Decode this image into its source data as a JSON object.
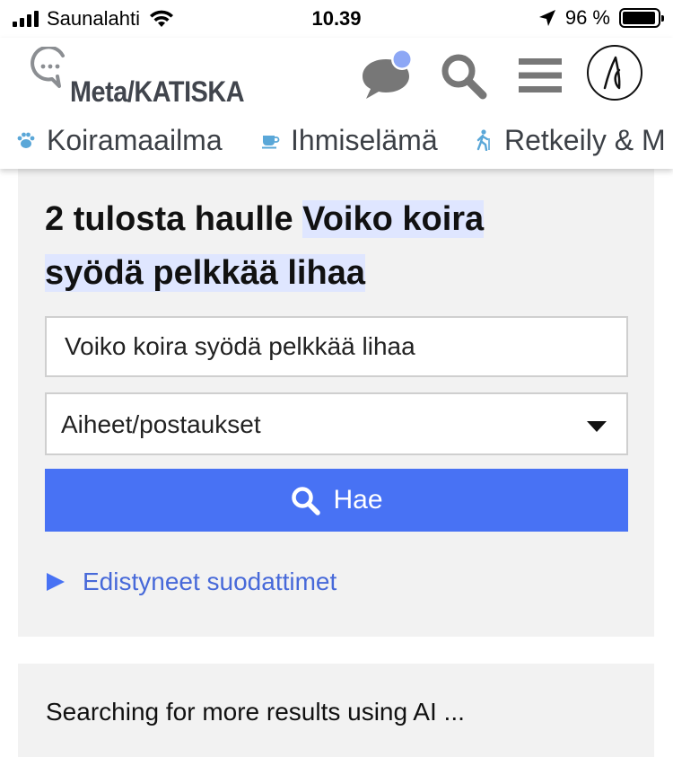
{
  "status_bar": {
    "carrier": "Saunalahti",
    "time": "10.39",
    "battery_percent": "96 %",
    "battery_level": 0.96,
    "icons": [
      "signal-icon",
      "wifi-icon",
      "location-arrow-icon",
      "battery-icon"
    ]
  },
  "header": {
    "logo_text": "Meta/KATISKA",
    "icons": [
      "chat-bubble-icon",
      "notification-dot",
      "search-icon",
      "hamburger-menu-icon",
      "user-avatar"
    ],
    "colors": {
      "icon_gray": "#777777",
      "notification_dot": "#8da7f5"
    }
  },
  "categories": [
    {
      "label": "Koiramaailma",
      "icon": "paw-icon",
      "color": "#5aa7d8"
    },
    {
      "label": "Ihmiselämä",
      "icon": "coffee-cup-icon",
      "color": "#5aa7d8"
    },
    {
      "label": "Retkeily & M",
      "icon": "hiker-icon",
      "color": "#5aa7d8"
    }
  ],
  "search": {
    "results_prefix": "2 tulosta haulle ",
    "query_part1": "Voiko koira",
    "query_part2": "syödä pelkkää lihaa",
    "input_value": "Voiko koira syödä pelkkää lihaa",
    "scope_selected": "Aiheet/postaukset",
    "button_label": "Hae",
    "advanced_filters_label": "Edistyneet suodattimet",
    "colors": {
      "accent": "#4872f4",
      "highlight": "#dfe6ff",
      "panel_bg": "#f2f2f2"
    }
  },
  "ai_search": {
    "status_text": "Searching for more results using AI ..."
  }
}
